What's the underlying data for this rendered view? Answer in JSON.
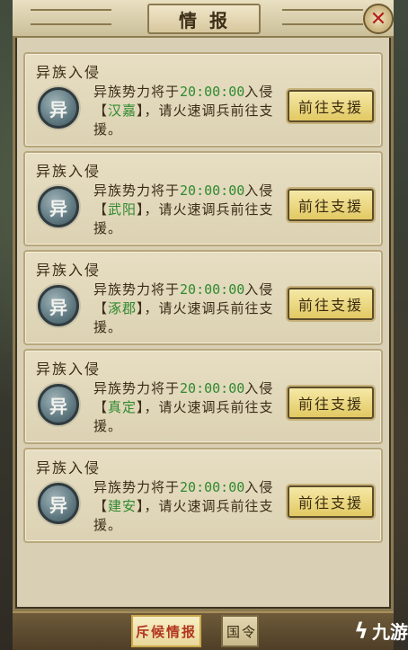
{
  "window": {
    "title": "情报",
    "close_glyph": "✕"
  },
  "alerts": [
    {
      "title": "异族入侵",
      "emblem": "异",
      "text_before": "异族势力将于",
      "time": "20:00:00",
      "text_mid": "入侵【",
      "place": "汉嘉",
      "text_after": "】，请火速调兵前往支援。",
      "button": "前往支援"
    },
    {
      "title": "异族入侵",
      "emblem": "异",
      "text_before": "异族势力将于",
      "time": "20:00:00",
      "text_mid": "入侵【",
      "place": "武阳",
      "text_after": "】，请火速调兵前往支援。",
      "button": "前往支援"
    },
    {
      "title": "异族入侵",
      "emblem": "异",
      "text_before": "异族势力将于",
      "time": "20:00:00",
      "text_mid": "入侵【",
      "place": "涿郡",
      "text_after": "】，请火速调兵前往支援。",
      "button": "前往支援"
    },
    {
      "title": "异族入侵",
      "emblem": "异",
      "text_before": "异族势力将于",
      "time": "20:00:00",
      "text_mid": "入侵【",
      "place": "真定",
      "text_after": "】，请火速调兵前往支援。",
      "button": "前往支援"
    },
    {
      "title": "异族入侵",
      "emblem": "异",
      "text_before": "异族势力将于",
      "time": "20:00:00",
      "text_mid": "入侵【",
      "place": "建安",
      "text_after": "】，请火速调兵前往支援。",
      "button": "前往支援"
    }
  ],
  "tabs": {
    "active": "斥候情报",
    "inactive": "国令"
  },
  "watermark": {
    "logo": "ϟ",
    "text": "九游"
  },
  "colors": {
    "highlight_green": "#2f8a2f",
    "active_tab_text": "#b3361f"
  }
}
